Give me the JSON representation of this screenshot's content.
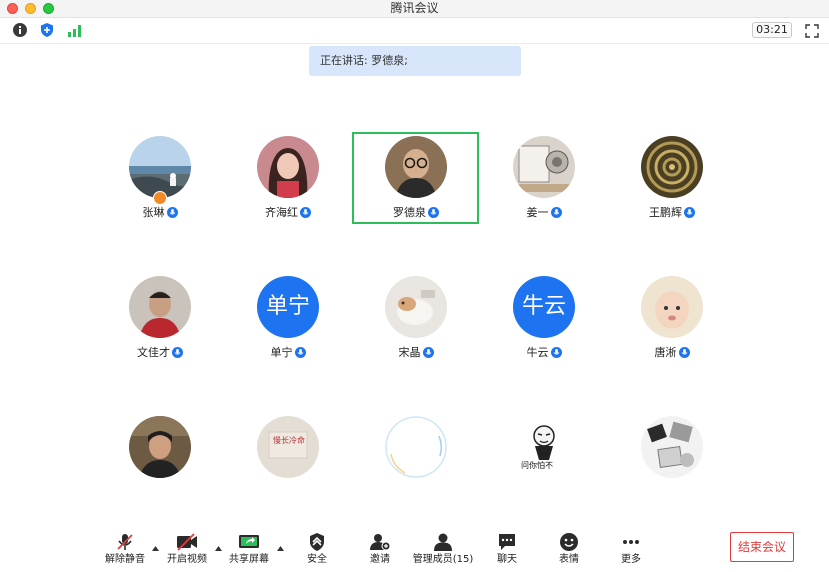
{
  "window": {
    "title": "腾讯会议"
  },
  "toolbar": {
    "timer": "03:21"
  },
  "speaking": {
    "label": "正在讲话: 罗德泉;"
  },
  "participants": [
    {
      "name": "张琳",
      "avatar": "photo"
    },
    {
      "name": "齐海红",
      "avatar": "photo"
    },
    {
      "name": "罗德泉",
      "avatar": "photo"
    },
    {
      "name": "姜一",
      "avatar": "photo"
    },
    {
      "name": "王鹏辉",
      "avatar": "photo"
    },
    {
      "name": "文佳才",
      "avatar": "photo"
    },
    {
      "name": "单宁",
      "avatar": "text",
      "avatar_text": "单宁"
    },
    {
      "name": "宋晶",
      "avatar": "photo"
    },
    {
      "name": "牛云",
      "avatar": "text",
      "avatar_text": "牛云"
    },
    {
      "name": "唐淅",
      "avatar": "photo"
    },
    {
      "name": "",
      "avatar": "photo"
    },
    {
      "name": "",
      "avatar": "photo"
    },
    {
      "name": "",
      "avatar": "photo"
    },
    {
      "name": "",
      "avatar": "sticker",
      "sticker_text": "问你怕不"
    },
    {
      "name": "",
      "avatar": "photo"
    }
  ],
  "sign_avatar_text": "慢长冷命",
  "controls": {
    "unmute": "解除静音",
    "start_video": "开启视频",
    "share_screen": "共享屏幕",
    "security": "安全",
    "invite": "邀请",
    "manage_members": "管理成员(15)",
    "chat": "聊天",
    "reactions": "表情",
    "more": "更多",
    "end_meeting": "结束会议"
  },
  "colors": {
    "accent": "#1e74f0",
    "active_speaker": "#2dbe5a",
    "end": "#e33a3a",
    "banner": "#d7e6fa"
  }
}
